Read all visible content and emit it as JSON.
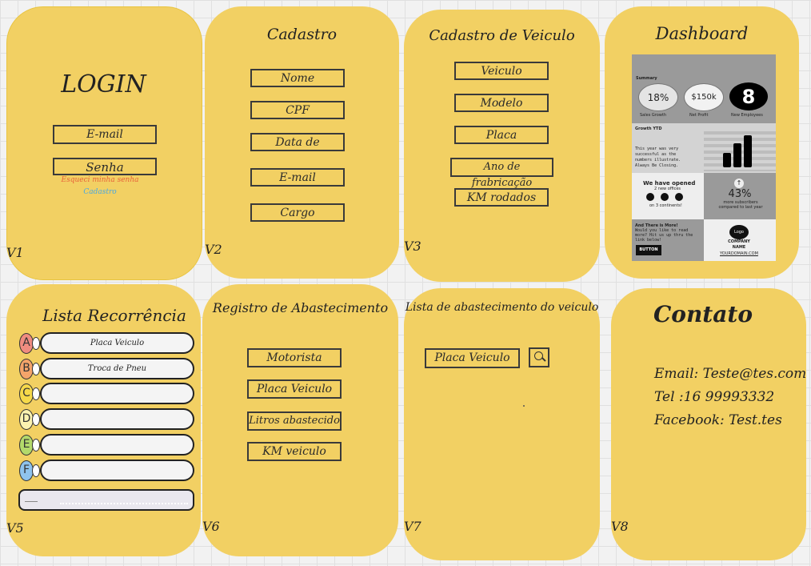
{
  "v1": {
    "title": "LOGIN",
    "email": "E-mail",
    "senha": "Senha",
    "forgot": "Esqueci minha senha",
    "cadastro": "Cadastro",
    "version": "V1"
  },
  "v2": {
    "title": "Cadastro",
    "fields": [
      "Nome",
      "CPF",
      "Data de",
      "E-mail",
      "Cargo"
    ],
    "version": "V2"
  },
  "v3": {
    "title": "Cadastro de Veiculo",
    "fields": [
      "Veiculo",
      "Modelo",
      "Placa",
      "Ano de frabricação",
      "KM rodados"
    ],
    "version": "V3"
  },
  "v4": {
    "title": "Dashboard",
    "summary": "Summary",
    "stats": [
      {
        "value": "18%",
        "label": "Sales Growth"
      },
      {
        "value": "$150k",
        "label": "Net Profit"
      },
      {
        "value": "8",
        "label": "New Employees"
      }
    ],
    "growth_title": "Growth YTD",
    "growth_text": "This year was very successful as the numbers illustrate. Always Be Closing.",
    "opened_title": "We have opened",
    "opened_sub1": "2 new offices",
    "opened_sub2": "on 3 continents!",
    "percent": "43%",
    "percent_sub": "more subscribers compared to last year",
    "more_title": "And There is More!",
    "more_text": "Would you like to read more? Hit us up thru the link below!",
    "button": "BUTTON",
    "logo": "Logo",
    "company": "COMPANY NAME",
    "domain": "YOURDOMAIN.COM",
    "version": "V4"
  },
  "v5": {
    "title": "Lista Recorrência",
    "rows": [
      {
        "letter": "A",
        "text": "Placa Veiculo",
        "color": "#f08c80"
      },
      {
        "letter": "B",
        "text": "Troca de Pneu",
        "color": "#f5a46a"
      },
      {
        "letter": "C",
        "text": "",
        "color": "#f6d94a"
      },
      {
        "letter": "D",
        "text": "",
        "color": "#fbf2b0"
      },
      {
        "letter": "E",
        "text": "",
        "color": "#b3d96b"
      },
      {
        "letter": "F",
        "text": "",
        "color": "#8fc3ec"
      }
    ],
    "version": "V5"
  },
  "v6": {
    "title": "Registro de Abastecimento",
    "fields": [
      "Motorista",
      "Placa Veiculo",
      "Litros abastecido",
      "KM veiculo"
    ],
    "version": "V6"
  },
  "v7": {
    "title": "Lista de abastecimento do veiculo",
    "search_field": "Placa Veiculo",
    "version": "V7"
  },
  "v8": {
    "title": "Contato",
    "email": "Email: Teste@tes.com",
    "tel": "Tel :16 99993332",
    "facebook": "Facebook: Test.tes",
    "version": "V8"
  },
  "colors": {
    "card": "#f2d063",
    "forgot": "#e8623a",
    "cadastro_link": "#4aa8e0"
  }
}
